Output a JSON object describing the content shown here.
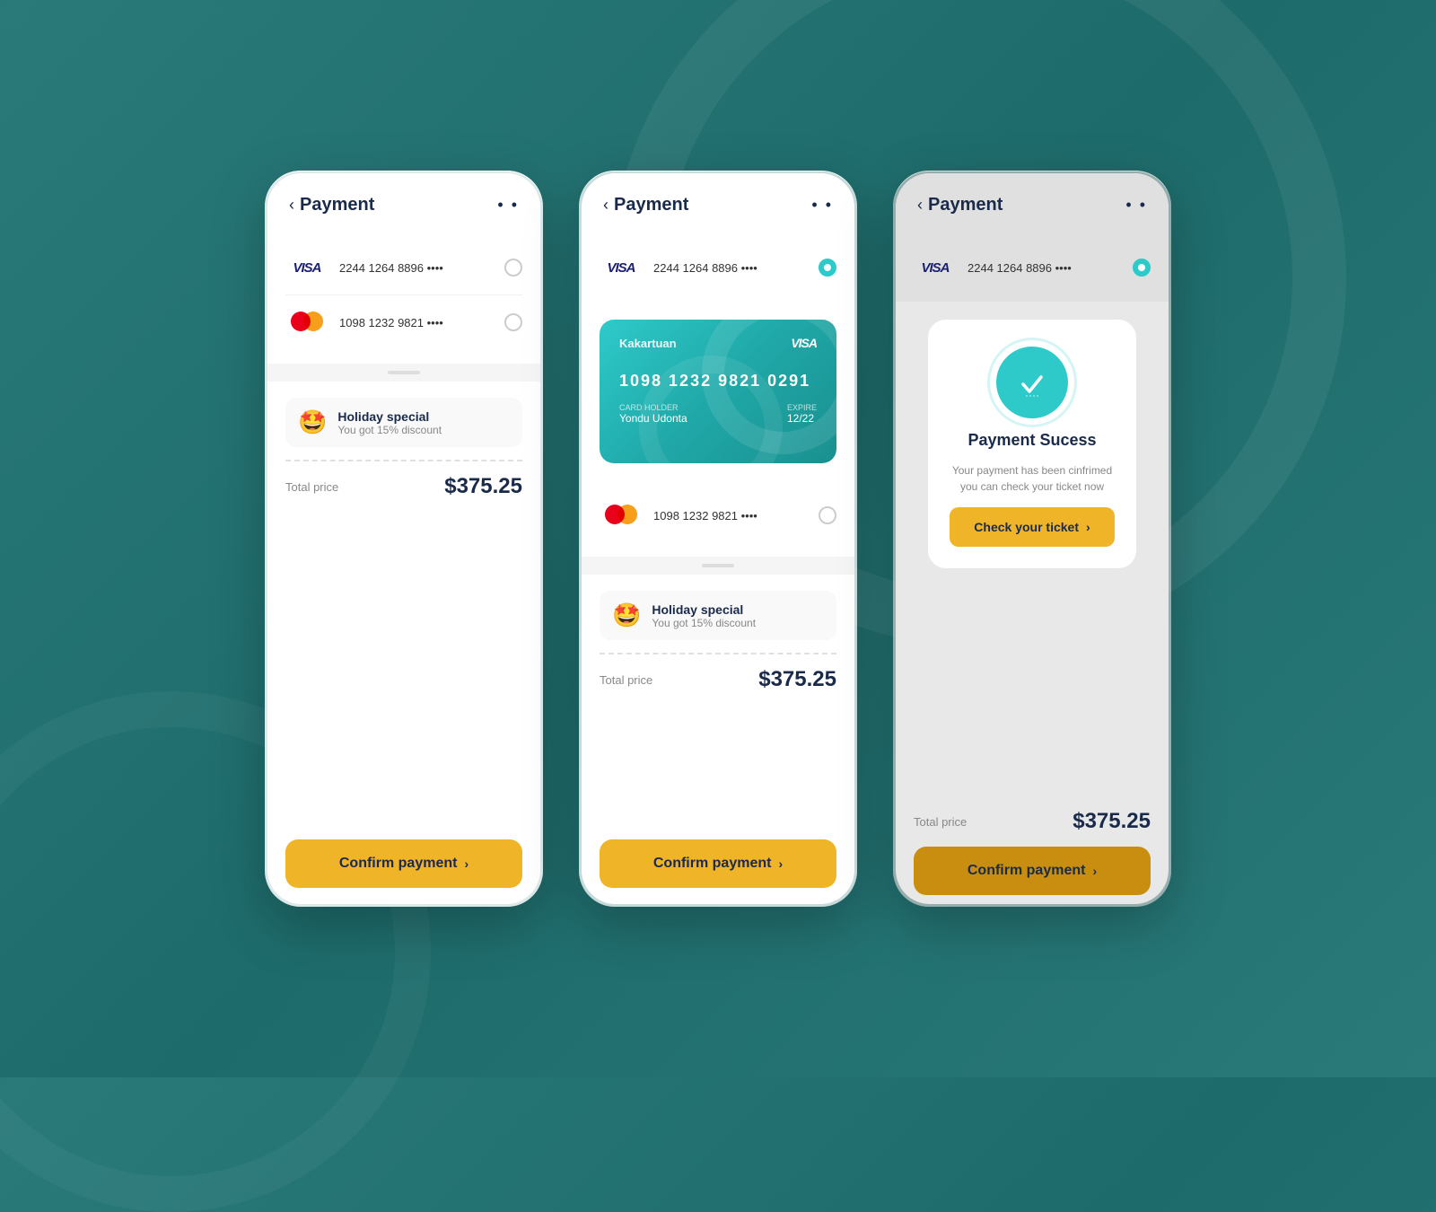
{
  "background_color": "#2a7a7a",
  "screens": [
    {
      "id": "screen-1",
      "header": {
        "back_label": "‹",
        "title": "Payment",
        "more": "• •"
      },
      "cards": [
        {
          "brand": "VISA",
          "number": "2244  1264  8896  ••••",
          "selected": false
        },
        {
          "brand": "MASTERCARD",
          "number": "1098  1232  9821  ••••",
          "selected": false
        }
      ],
      "promo": {
        "emoji": "🤩",
        "title": "Holiday special",
        "subtitle": "You got 15% discount"
      },
      "price_label": "Total price",
      "price_value": "$375.25",
      "confirm_label": "Confirm payment",
      "confirm_chevron": "›"
    },
    {
      "id": "screen-2",
      "header": {
        "back_label": "‹",
        "title": "Payment",
        "more": "• •"
      },
      "cards": [
        {
          "brand": "VISA",
          "number": "2244  1264  8896  ••••",
          "selected": true
        }
      ],
      "card_visual": {
        "bank_name": "Kakartuan",
        "brand": "VISA",
        "number": "1098   1232   9821   0291",
        "holder_label": "Card Holder",
        "holder_value": "Yondu Udonta",
        "expire_label": "Expire",
        "expire_value": "12/22"
      },
      "cards_below": [
        {
          "brand": "MASTERCARD",
          "number": "1098  1232  9821  ••••",
          "selected": false
        }
      ],
      "promo": {
        "emoji": "🤩",
        "title": "Holiday special",
        "subtitle": "You got 15% discount"
      },
      "price_label": "Total price",
      "price_value": "$375.25",
      "confirm_label": "Confirm payment",
      "confirm_chevron": "›"
    },
    {
      "id": "screen-3",
      "header": {
        "back_label": "‹",
        "title": "Payment",
        "more": "• •"
      },
      "visa_row": {
        "brand": "VISA",
        "number": "2244  1264  8896  ••••",
        "selected": true
      },
      "success": {
        "title": "Payment Sucess",
        "description": "Your payment has been cinfrimed\nyou can check your ticket now",
        "check_label": "Check your ticket",
        "check_chevron": "›"
      },
      "price_label": "Total price",
      "price_value": "$375.25",
      "confirm_label": "Confirm payment",
      "confirm_chevron": "›"
    }
  ]
}
